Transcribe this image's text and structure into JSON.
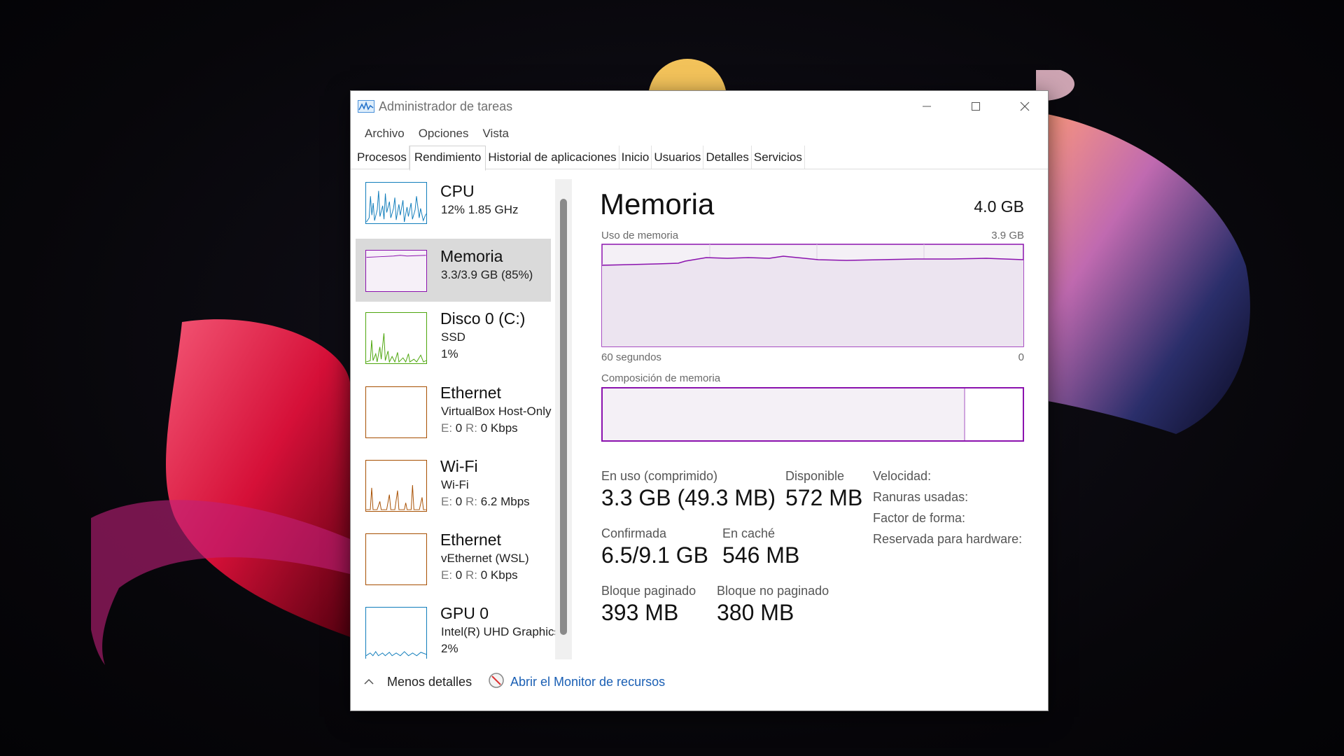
{
  "window": {
    "title": "Administrador de tareas"
  },
  "menu": [
    "Archivo",
    "Opciones",
    "Vista"
  ],
  "tabs": [
    "Procesos",
    "Rendimiento",
    "Historial de aplicaciones",
    "Inicio",
    "Usuarios",
    "Detalles",
    "Servicios"
  ],
  "active_tab": "Rendimiento",
  "sidebar": [
    {
      "title": "CPU",
      "line1": "12%  1.85 GHz",
      "color": "#117dbb"
    },
    {
      "title": "Memoria",
      "line1": "3.3/3.9 GB (85%)",
      "color": "#8b12ae",
      "active": true
    },
    {
      "title": "Disco 0 (C:)",
      "line1": "SSD",
      "line2": "1%",
      "color": "#4da60c"
    },
    {
      "title": "Ethernet",
      "line1": "VirtualBox Host-Only",
      "line2_e": "E:",
      "line2_ev": "0",
      "line2_r": "R:",
      "line2_rv": "0 Kbps",
      "color": "#a74f01"
    },
    {
      "title": "Wi-Fi",
      "line1": "Wi-Fi",
      "line2_e": "E:",
      "line2_ev": "0",
      "line2_r": "R:",
      "line2_rv": "6.2 Mbps",
      "color": "#a74f01"
    },
    {
      "title": "Ethernet",
      "line1": "vEthernet (WSL)",
      "line2_e": "E:",
      "line2_ev": "0",
      "line2_r": "R:",
      "line2_rv": "0 Kbps",
      "color": "#a74f01"
    },
    {
      "title": "GPU 0",
      "line1": "Intel(R) UHD Graphics",
      "line2": "2%",
      "color": "#117dbb"
    }
  ],
  "main": {
    "title": "Memoria",
    "total": "4.0 GB",
    "usage_label": "Uso de memoria",
    "usage_max": "3.9 GB",
    "time_left": "60 segundos",
    "time_right": "0",
    "composition_label": "Composición de memoria",
    "accent": "#8b12ae",
    "in_use_fraction": 0.86
  },
  "stats": {
    "in_use_label": "En uso (comprimido)",
    "in_use_value": "3.3 GB (49.3 MB)",
    "available_label": "Disponible",
    "available_value": "572 MB",
    "committed_label": "Confirmada",
    "committed_value": "6.5/9.1 GB",
    "cached_label": "En caché",
    "cached_value": "546 MB",
    "paged_label": "Bloque paginado",
    "paged_value": "393 MB",
    "nonpaged_label": "Bloque no paginado",
    "nonpaged_value": "380 MB"
  },
  "specs": [
    "Velocidad:",
    "Ranuras usadas:",
    "Factor de forma:",
    "Reservada para hardware:"
  ],
  "footer": {
    "less_details": "Menos detalles",
    "resource_monitor": "Abrir el Monitor de recursos"
  }
}
